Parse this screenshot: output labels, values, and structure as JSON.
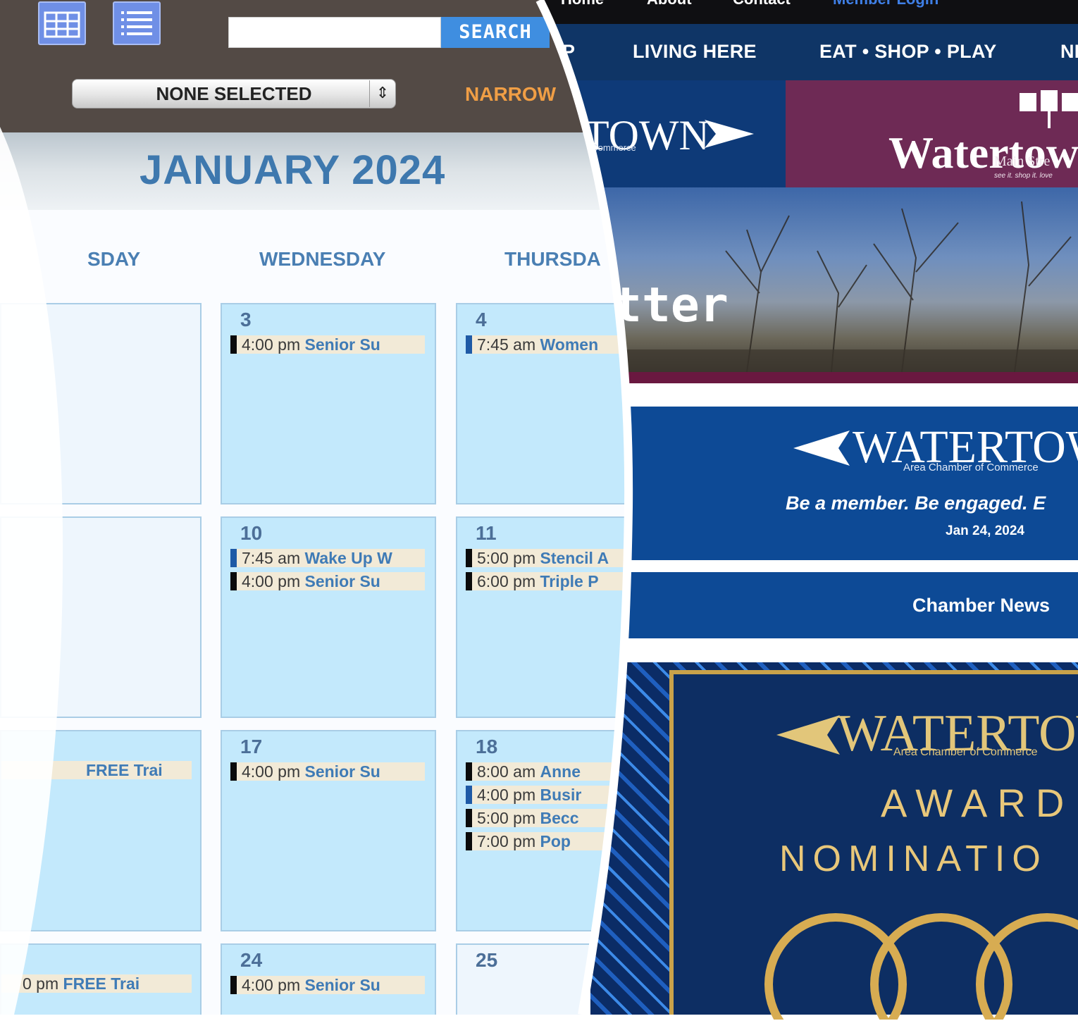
{
  "newsletter": {
    "top_nav": [
      "Home",
      "About",
      "Contact",
      "Member Login"
    ],
    "main_nav": [
      "P",
      "LIVING HERE",
      "EAT • SHOP • PLAY",
      "NI"
    ],
    "logo_left_text": "TOWN",
    "logo_left_sub": "f Commerce",
    "logo_right_text": "Watertown",
    "logo_right_sub": "Main Stre",
    "logo_right_tag": "see it. shop it. love",
    "hero_text": "tter",
    "card1": {
      "logo_text": "WATERTOW",
      "logo_sub": "Area Chamber of Commerce",
      "tagline": "Be a member. Be engaged. E",
      "date": "Jan 24, 2024"
    },
    "card2": {
      "title": "Chamber News"
    },
    "award": {
      "logo_text": "WATERTOW",
      "logo_sub": "Area Chamber of Commerce",
      "line1": "AWARD",
      "line2": "NOMINATIO"
    }
  },
  "calendar": {
    "search_placeholder": "",
    "search_button": "SEARCH",
    "select_value": "NONE SELECTED",
    "narrow_label": "NARROW",
    "month_title": "JANUARY 2024",
    "day_names": [
      "SDAY",
      "WEDNESDAY",
      "THURSDA"
    ],
    "weeks": [
      {
        "tue": {
          "day": "",
          "events": []
        },
        "wed": {
          "day": "3",
          "events": [
            {
              "time": "4:00 pm",
              "name": "Senior Su",
              "bar": "black"
            }
          ]
        },
        "thu": {
          "day": "4",
          "events": [
            {
              "time": "7:45 am",
              "name": "Women",
              "bar": "blue"
            }
          ]
        }
      },
      {
        "tue": {
          "day": "",
          "events": []
        },
        "wed": {
          "day": "10",
          "events": [
            {
              "time": "7:45 am",
              "name": "Wake Up W",
              "bar": "blue"
            },
            {
              "time": "4:00 pm",
              "name": "Senior Su",
              "bar": "black"
            }
          ]
        },
        "thu": {
          "day": "11",
          "events": [
            {
              "time": "5:00 pm",
              "name": "Stencil A",
              "bar": "black"
            },
            {
              "time": "6:00 pm",
              "name": "Triple P",
              "bar": "black"
            }
          ]
        }
      },
      {
        "tue": {
          "day": "",
          "events": [
            {
              "time": "",
              "name": "FREE Trai",
              "bar": "none"
            }
          ]
        },
        "wed": {
          "day": "17",
          "events": [
            {
              "time": "4:00 pm",
              "name": "Senior Su",
              "bar": "black"
            }
          ]
        },
        "thu": {
          "day": "18",
          "events": [
            {
              "time": "8:00 am",
              "name": "Anne",
              "bar": "black"
            },
            {
              "time": "4:00 pm",
              "name": "Busir",
              "bar": "blue"
            },
            {
              "time": "5:00 pm",
              "name": "Becc",
              "bar": "black"
            },
            {
              "time": "7:00 pm",
              "name": "Pop",
              "bar": "black"
            }
          ]
        }
      },
      {
        "tue": {
          "day": "",
          "events": [
            {
              "time": "0 pm",
              "name": "FREE Trai",
              "bar": "none"
            }
          ]
        },
        "wed": {
          "day": "24",
          "events": [
            {
              "time": "4:00 pm",
              "name": "Senior Su",
              "bar": "black"
            }
          ]
        },
        "thu": {
          "day": "25",
          "events": []
        }
      }
    ]
  },
  "colors": {
    "cal_header_bg": "#534a45",
    "cell_bg": "#c3e9fc",
    "accent_blue": "#3f8ee0",
    "narrow_orange": "#f09e45",
    "nav_bg": "#0f3566",
    "card_bg": "#0d4a96",
    "gold": "#c9a24a"
  }
}
